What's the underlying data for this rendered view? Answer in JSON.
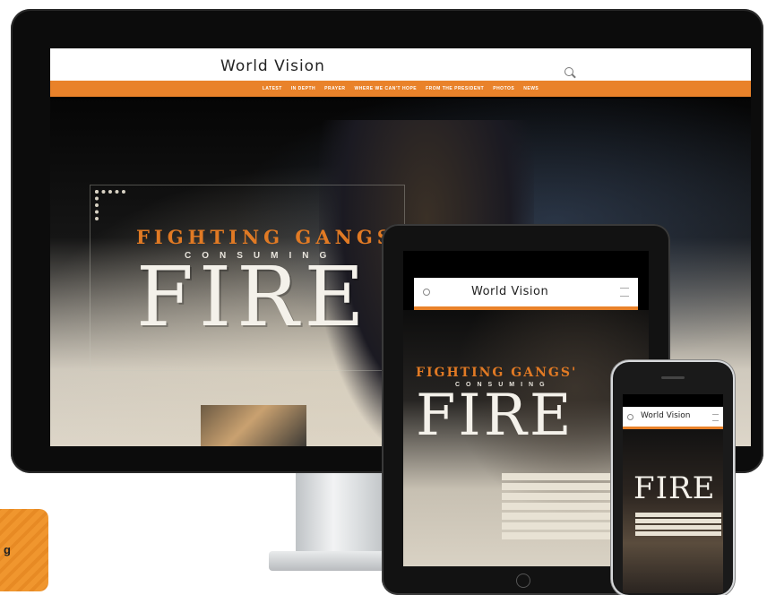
{
  "brand": "World Vision",
  "desktop": {
    "nav_items": [
      "LATEST",
      "IN DEPTH",
      "PRAYER",
      "WHERE WE CAN'T HOPE",
      "FROM THE PRESIDENT",
      "PHOTOS",
      "NEWS"
    ],
    "headline_top": "FIGHTING GANGS'",
    "headline_mid": "CONSUMING",
    "headline_main": "FIRE"
  },
  "tablet": {
    "headline_top": "FIGHTING GANGS'",
    "headline_mid": "CONSUMING",
    "headline_main": "FIRE"
  },
  "phone": {
    "headline_main": "FIRE"
  },
  "tag": {
    "label": "g"
  },
  "colors": {
    "accent": "#e9822a",
    "hero_text": "#f4f1ea"
  },
  "icons": [
    "search-icon",
    "menu-icon"
  ]
}
